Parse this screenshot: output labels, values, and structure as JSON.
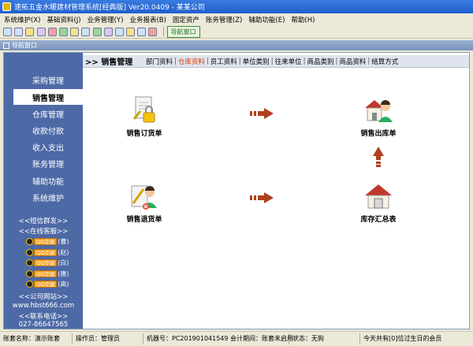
{
  "window": {
    "title": "速拓五金水暖建材管理系统[经典版] Ver20.0409 - 某某公司"
  },
  "menu": [
    "系统维护(X)",
    "基础资料(J)",
    "业务管理(Y)",
    "业务报表(B)",
    "固定资产",
    "账务管理(Z)",
    "辅助功能(E)",
    "帮助(H)"
  ],
  "toolbar": {
    "nav_button": "导航窗口"
  },
  "nav_window": {
    "title": "导航窗口"
  },
  "sidebar": {
    "items": [
      "采购管理",
      "销售管理",
      "仓库管理",
      "收款付款",
      "收入支出",
      "账务管理",
      "辅助功能",
      "系统维护"
    ],
    "active": "销售管理",
    "links": {
      "sms": "<<短信群发>>",
      "online": "<<在线客服>>",
      "website": "<<公司网站>>",
      "website_url": "www.hbst666.com",
      "phone_title": "<<联系电话>>",
      "phone": "027-86647565"
    },
    "qq": [
      {
        "btn": "QQ交谈",
        "name": "(曹)"
      },
      {
        "btn": "QQ交谈",
        "name": "(赵)"
      },
      {
        "btn": "QQ交谈",
        "name": "(白)"
      },
      {
        "btn": "QQ交谈",
        "name": "(唐)"
      },
      {
        "btn": "QQ交谈",
        "name": "(高)"
      }
    ]
  },
  "content": {
    "section_title": ">> 销售管理",
    "tabs": [
      "部门资料",
      "仓库资料",
      "员工资料",
      "单位类别",
      "往来单位",
      "商品类别",
      "商品资料",
      "结算方式"
    ],
    "selected_tab": "仓库资料",
    "workflow": {
      "sales_order": "销售订货单",
      "sales_outbound": "销售出库单",
      "sales_return": "销售退货单",
      "inventory_summary": "库存汇总表"
    }
  },
  "status": {
    "account_set": "账套名称：演示账套",
    "operator": "操作员：管理员",
    "machine": "机器号：PC201901041549 会计期间：账套未启用",
    "state": "状态：无狗",
    "birthday": "今天共有[0]位过生日的会员"
  },
  "colors": {
    "sidebar_bg": "#4d69a6",
    "selected_tab": "#e03c00",
    "arrow": "#b0401e",
    "title_bar": "#1f5fcf"
  }
}
